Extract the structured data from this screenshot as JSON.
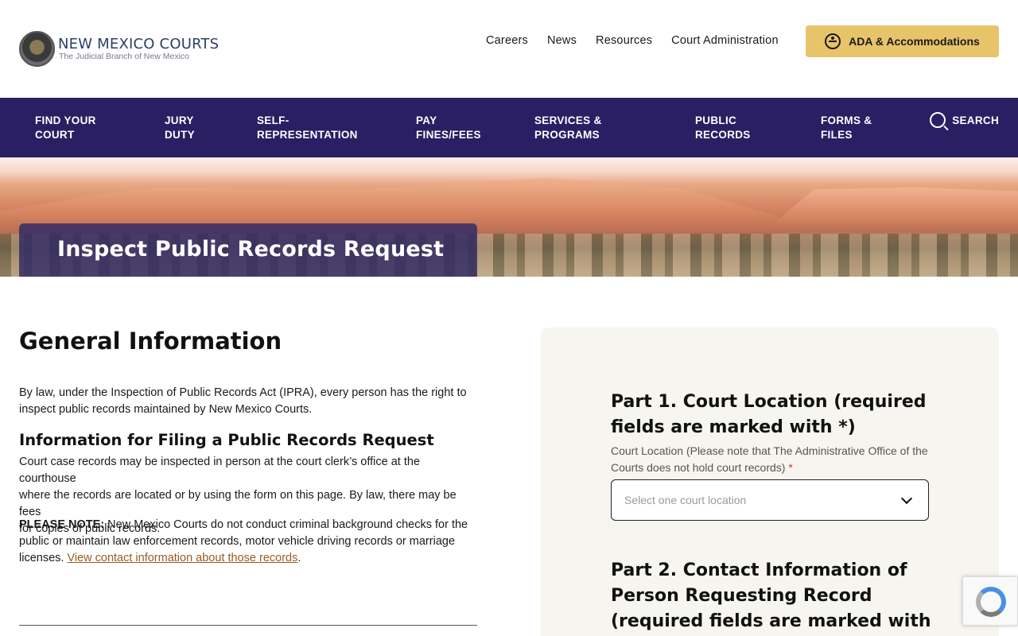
{
  "header": {
    "logo_title": "NEW MEXICO COURTS",
    "logo_subtitle": "The Judicial Branch of New Mexico",
    "util_nav": [
      "Careers",
      "News",
      "Resources",
      "Court Administration"
    ],
    "ada_label": "ADA & Accommodations"
  },
  "main_nav": {
    "items": [
      {
        "line1": "FIND YOUR",
        "line2": "COURT"
      },
      {
        "line1": "JURY",
        "line2": "DUTY"
      },
      {
        "line1": "SELF-",
        "line2": "REPRESENTATION"
      },
      {
        "line1": "PAY",
        "line2": "FINES/FEES"
      },
      {
        "line1": "SERVICES &",
        "line2": "PROGRAMS"
      },
      {
        "line1": "PUBLIC",
        "line2": "RECORDS"
      },
      {
        "line1": "FORMS &",
        "line2": "FILES"
      }
    ],
    "search_label": "SEARCH"
  },
  "hero": {
    "title": "Inspect Public Records Request"
  },
  "general": {
    "heading": "General Information",
    "p1_line1": "By law, under the Inspection of Public Records Act (IPRA), every person has the right to",
    "p1_line2": "inspect public records maintained by New Mexico Courts.",
    "filing_heading": "Information for Filing a Public Records Request",
    "p2_line1": "Court case records may be inspected in person at the court clerk’s office at the courthouse",
    "p2_line2": "where the records are located or by using the form on this page. By law, there may be fees",
    "p2_line3": "for copies of public records.",
    "note_label": "PLEASE NOTE:",
    "note_line1": " New Mexico Courts do not conduct criminal background checks for the",
    "note_line2": "public or maintain law enforcement records, motor vehicle driving records or marriage",
    "note_line3": "licenses. ",
    "note_link": "View contact information about those records",
    "note_end": "."
  },
  "form": {
    "part1_heading": "Part 1. Court Location (required fields are marked with *)",
    "location_label": "Court Location (Please note that The Administrative Office of the Courts does not hold court records)",
    "required_mark": "*",
    "location_placeholder": "Select one court location",
    "part2_heading": "Part 2. Contact Information of Person Requesting Record (required fields are marked with"
  },
  "colors": {
    "nav_bg": "#2a1f63",
    "ada_bg": "#e7c36a",
    "link": "#9a5b20",
    "panel_bg": "#f7f5ef"
  }
}
